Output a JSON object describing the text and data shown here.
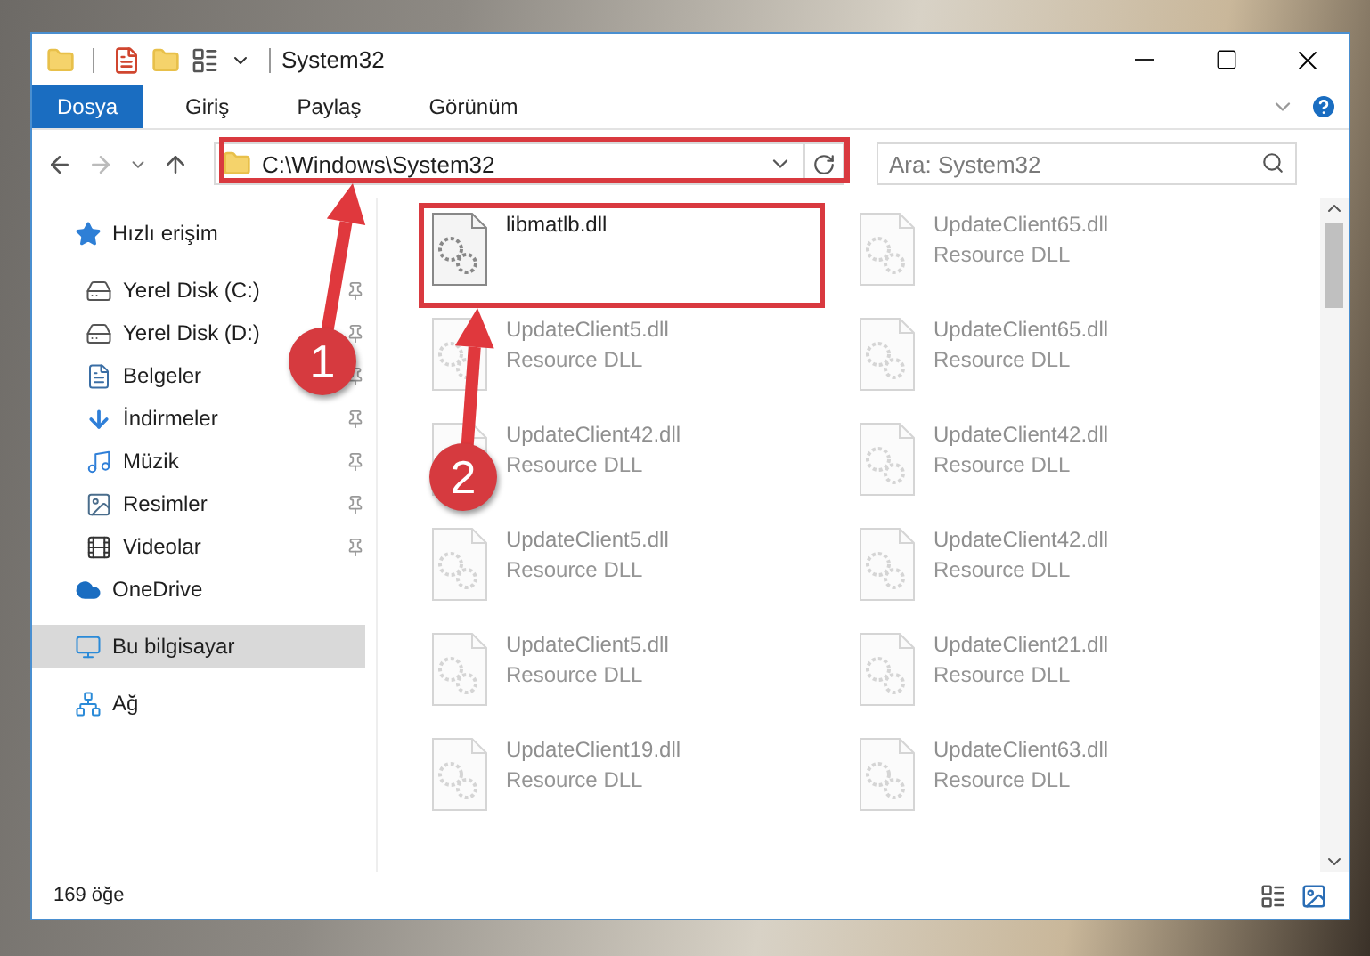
{
  "window": {
    "title": "System32"
  },
  "ribbon_tabs": [
    {
      "label": "Dosya",
      "selected": true
    },
    {
      "label": "Giriş",
      "selected": false
    },
    {
      "label": "Paylaş",
      "selected": false
    },
    {
      "label": "Görünüm",
      "selected": false
    }
  ],
  "address_bar": {
    "path": "C:\\Windows\\System32"
  },
  "search": {
    "placeholder": "Ara: System32"
  },
  "sidebar": {
    "items": [
      {
        "kind": "star",
        "label": "Hızlı erişim",
        "pinned": false,
        "selected": false,
        "children": [
          {
            "kind": "drive-c",
            "label": "Yerel Disk (C:)",
            "pinned": true,
            "selected": false
          },
          {
            "kind": "drive",
            "label": "Yerel Disk (D:)",
            "pinned": true,
            "selected": false
          },
          {
            "kind": "document",
            "label": "Belgeler",
            "pinned": true,
            "selected": false
          },
          {
            "kind": "download",
            "label": "İndirmeler",
            "pinned": true,
            "selected": false
          },
          {
            "kind": "music",
            "label": "Müzik",
            "pinned": true,
            "selected": false
          },
          {
            "kind": "picture",
            "label": "Resimler",
            "pinned": true,
            "selected": false
          },
          {
            "kind": "video",
            "label": "Videolar",
            "pinned": true,
            "selected": false
          }
        ]
      },
      {
        "kind": "cloud",
        "label": "OneDrive",
        "pinned": false,
        "selected": false
      },
      {
        "kind": "computer",
        "label": "Bu bilgisayar",
        "pinned": false,
        "selected": true
      },
      {
        "kind": "network",
        "label": "Ağ",
        "pinned": false,
        "selected": false
      }
    ]
  },
  "files": [
    {
      "name": "libmatlb.dll",
      "faded": false
    },
    {
      "name": "UpdateClient65.dll",
      "type": "Resource DLL",
      "faded": true
    },
    {
      "name": "UpdateClient5.dll",
      "type": "Resource DLL",
      "faded": true
    },
    {
      "name": "UpdateClient65.dll",
      "type": "Resource DLL",
      "faded": true
    },
    {
      "name": "UpdateClient42.dll",
      "type": "Resource DLL",
      "faded": true
    },
    {
      "name": "UpdateClient42.dll",
      "type": "Resource DLL",
      "faded": true
    },
    {
      "name": "UpdateClient5.dll",
      "type": "Resource DLL",
      "faded": true
    },
    {
      "name": "UpdateClient42.dll",
      "type": "Resource DLL",
      "faded": true
    },
    {
      "name": "UpdateClient5.dll",
      "type": "Resource DLL",
      "faded": true
    },
    {
      "name": "UpdateClient21.dll",
      "type": "Resource DLL",
      "faded": true
    },
    {
      "name": "UpdateClient19.dll",
      "type": "Resource DLL",
      "faded": true
    },
    {
      "name": "UpdateClient63.dll",
      "type": "Resource DLL",
      "faded": true
    }
  ],
  "status_bar": {
    "count": "169 öğe"
  },
  "annotations": [
    {
      "label": "1"
    },
    {
      "label": "2"
    }
  ]
}
